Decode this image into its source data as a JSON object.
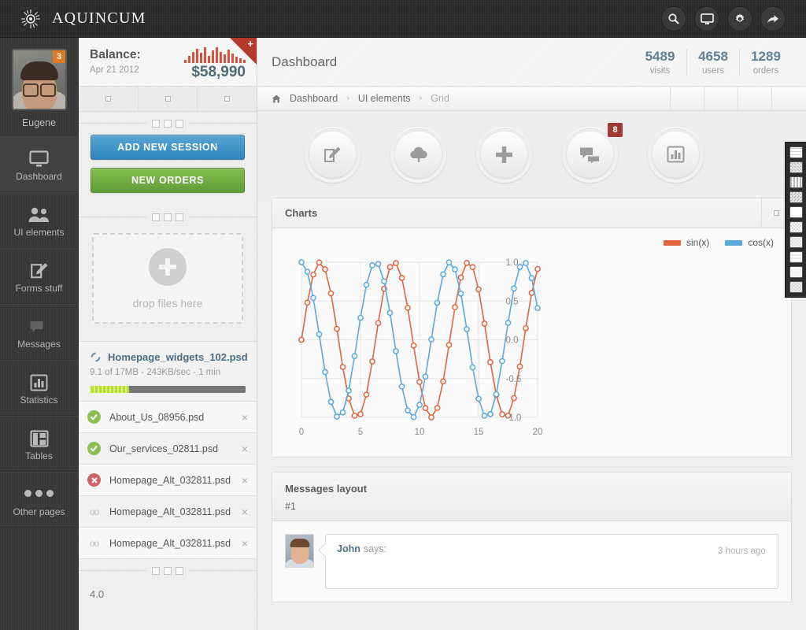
{
  "app": {
    "brand": "AQUINCUM"
  },
  "header": {
    "icons": [
      {
        "name": "search-icon",
        "label": "Search"
      },
      {
        "name": "monitor-icon",
        "label": "Display"
      },
      {
        "name": "gear-icon",
        "label": "Settings"
      },
      {
        "name": "share-icon",
        "label": "Share"
      }
    ]
  },
  "profile": {
    "name": "Eugene",
    "badge": "3"
  },
  "sidebar": {
    "items": [
      {
        "label": "Dashboard",
        "icon": "monitor-icon",
        "active": true
      },
      {
        "label": "UI elements",
        "icon": "users-icon",
        "active": false
      },
      {
        "label": "Forms stuff",
        "icon": "edit-square-icon",
        "active": false
      },
      {
        "label": "Messages",
        "icon": "chat-icon",
        "active": false
      },
      {
        "label": "Statistics",
        "icon": "bar-chart-icon",
        "active": false
      },
      {
        "label": "Tables",
        "icon": "table-icon",
        "active": false
      },
      {
        "label": "Other pages",
        "icon": "three-dots-icon",
        "active": false
      }
    ]
  },
  "balance": {
    "label": "Balance:",
    "date": "Apr 21 2012",
    "amount": "$58,990",
    "ribbon": "+",
    "sparkline": [
      4,
      9,
      14,
      18,
      13,
      20,
      9,
      16,
      20,
      14,
      11,
      17,
      12,
      8,
      6,
      4
    ]
  },
  "buttons": {
    "add_session": "ADD NEW SESSION",
    "new_orders": "NEW ORDERS"
  },
  "dropzone": {
    "text": "drop files here"
  },
  "upload": {
    "filename": "Homepage_widgets_102.psd",
    "meta": "9.1 of 17MB - 243KB/sec - 1 min",
    "progress": 25
  },
  "files": [
    {
      "name": "About_Us_08956.psd",
      "status": "ok",
      "close": "×"
    },
    {
      "name": "Our_services_02811.psd",
      "status": "ok",
      "close": "×"
    },
    {
      "name": "Homepage_Alt_032811.psd",
      "status": "error",
      "close": "×"
    },
    {
      "name": "Homepage_Alt_032811.psd",
      "status": "link",
      "close": "×"
    },
    {
      "name": "Homepage_Alt_032811.psd",
      "status": "link",
      "close": "×"
    }
  ],
  "sidebar_bottom": {
    "value": "4.0"
  },
  "main": {
    "page_title": "Dashboard",
    "stats": [
      {
        "num": "5489",
        "label": "visits"
      },
      {
        "num": "4658",
        "label": "users"
      },
      {
        "num": "1289",
        "label": "orders"
      }
    ],
    "breadcrumb": [
      {
        "label": "Dashboard",
        "current": false
      },
      {
        "label": "UI elements",
        "current": false
      },
      {
        "label": "Grid",
        "current": true
      }
    ],
    "breadcrumb_sep": "›",
    "actions": [
      {
        "name": "compose-button",
        "icon": "edit-square-icon",
        "badge": ""
      },
      {
        "name": "upload-button",
        "icon": "cloud-upload-icon",
        "badge": ""
      },
      {
        "name": "add-button",
        "icon": "plus-icon",
        "badge": ""
      },
      {
        "name": "messages-button",
        "icon": "chat-icon",
        "badge": "8"
      },
      {
        "name": "statistics-button",
        "icon": "bar-chart-icon",
        "badge": ""
      }
    ],
    "charts_panel_title": "Charts",
    "messages_panel_title": "Messages layout",
    "messages_number": "#1",
    "message": {
      "author": "John",
      "says": "says:",
      "time": "3 hours ago"
    }
  },
  "colors": {
    "sin": "#e2653f",
    "cos": "#5aaade",
    "blue_button": "#2f85bc",
    "green_button": "#5f9c36",
    "accent_link": "#4d6b86"
  },
  "chart_data": {
    "type": "line",
    "title": "Charts",
    "xlabel": "",
    "ylabel": "",
    "xlim": [
      0,
      20
    ],
    "ylim": [
      -1.0,
      1.0
    ],
    "xticks": [
      0,
      5,
      10,
      15,
      20
    ],
    "yticks": [
      -1.0,
      -0.5,
      0.0,
      0.5,
      1.0
    ],
    "ytick_labels": [
      "-1.0",
      "-0.5",
      "0.0",
      "0.5",
      "1.0"
    ],
    "grid": true,
    "legend_position": "top-right",
    "markers": "circle",
    "x": [
      0,
      0.5,
      1,
      1.5,
      2,
      2.5,
      3,
      3.5,
      4,
      4.5,
      5,
      5.5,
      6,
      6.5,
      7,
      7.5,
      8,
      8.5,
      9,
      9.5,
      10,
      10.5,
      11,
      11.5,
      12,
      12.5,
      13,
      13.5,
      14,
      14.5,
      15,
      15.5,
      16,
      16.5,
      17,
      17.5,
      18,
      18.5,
      19,
      19.5,
      20
    ],
    "series": [
      {
        "name": "sin(x)",
        "color": "#e2653f",
        "values": [
          0.0,
          0.479,
          0.841,
          0.997,
          0.909,
          0.598,
          0.141,
          -0.351,
          -0.757,
          -0.978,
          -0.959,
          -0.706,
          -0.279,
          0.215,
          0.657,
          0.938,
          0.989,
          0.798,
          0.412,
          -0.075,
          -0.544,
          -0.88,
          -1.0,
          -0.879,
          -0.537,
          -0.066,
          0.42,
          0.803,
          0.991,
          0.937,
          0.65,
          0.208,
          -0.288,
          -0.712,
          -0.961,
          -0.978,
          -0.751,
          -0.344,
          0.15,
          0.605,
          0.913
        ]
      },
      {
        "name": "cos(x)",
        "color": "#5aaade",
        "values": [
          1.0,
          0.878,
          0.54,
          0.071,
          -0.416,
          -0.801,
          -0.99,
          -0.936,
          -0.654,
          -0.211,
          0.284,
          0.709,
          0.96,
          0.977,
          0.754,
          0.347,
          -0.146,
          -0.602,
          -0.911,
          -0.997,
          -0.839,
          -0.475,
          0.004,
          0.477,
          0.844,
          0.998,
          0.907,
          0.595,
          0.137,
          -0.355,
          -0.76,
          -0.979,
          -0.958,
          -0.702,
          -0.275,
          0.219,
          0.661,
          0.939,
          0.989,
          0.796,
          0.408
        ]
      }
    ]
  },
  "swatches": [
    "grid-fine",
    "zigzag",
    "vertical-stripes",
    "diagonal-stripes",
    "cross",
    "checker-light",
    "dots",
    "grid-dense",
    "plain",
    "noise"
  ]
}
